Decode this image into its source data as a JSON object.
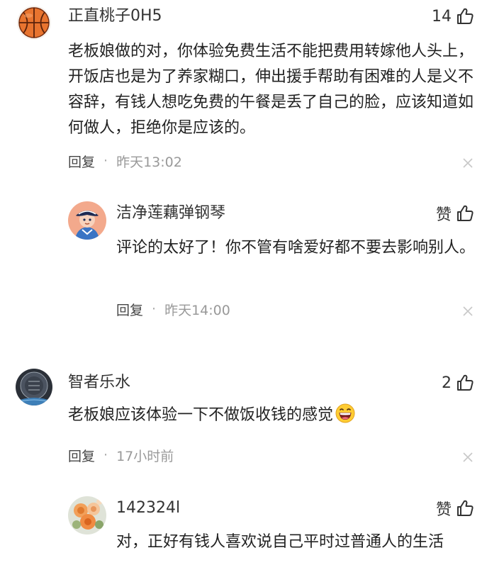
{
  "comments": [
    {
      "username": "正直桃子0H5",
      "like_count": "14",
      "text": "老板娘做的对，你体验免费生活不能把费用转嫁他人头上，开饭店也是为了养家糊口，伸出援手帮助有困难的人是义不容辞，有钱人想吃免费的午餐是丢了自己的脸，应该知道如何做人，拒绝你是应该的。",
      "reply_label": "回复",
      "separator": "·",
      "timestamp": "昨天13:02",
      "avatar_icon": "basketball-avatar"
    },
    {
      "username": "洁净莲藕弹钢琴",
      "like_count": "赞",
      "text": "评论的太好了！你不管有啥爱好都不要去影响别人。",
      "reply_label": "回复",
      "separator": "·",
      "timestamp": "昨天14:00",
      "avatar_icon": "cartoon-character-avatar"
    },
    {
      "username": "智者乐水",
      "like_count": "2",
      "text": "老板娘应该体验一下不做饭收钱的感觉",
      "reply_label": "回复",
      "separator": "·",
      "timestamp": "17小时前",
      "avatar_icon": "dark-emblem-avatar",
      "trailing_emoji": "grinning-face-emoji"
    },
    {
      "username": "142324l",
      "like_count": "赞",
      "text": "对，正好有钱人喜欢说自己平时过普通人的生活",
      "avatar_icon": "flower-avatar"
    }
  ],
  "icons": {
    "like": "thumbs-up-icon",
    "close": "close-icon"
  },
  "colors": {
    "text": "#222222",
    "meta": "#999999",
    "close": "#c8c8c8"
  }
}
